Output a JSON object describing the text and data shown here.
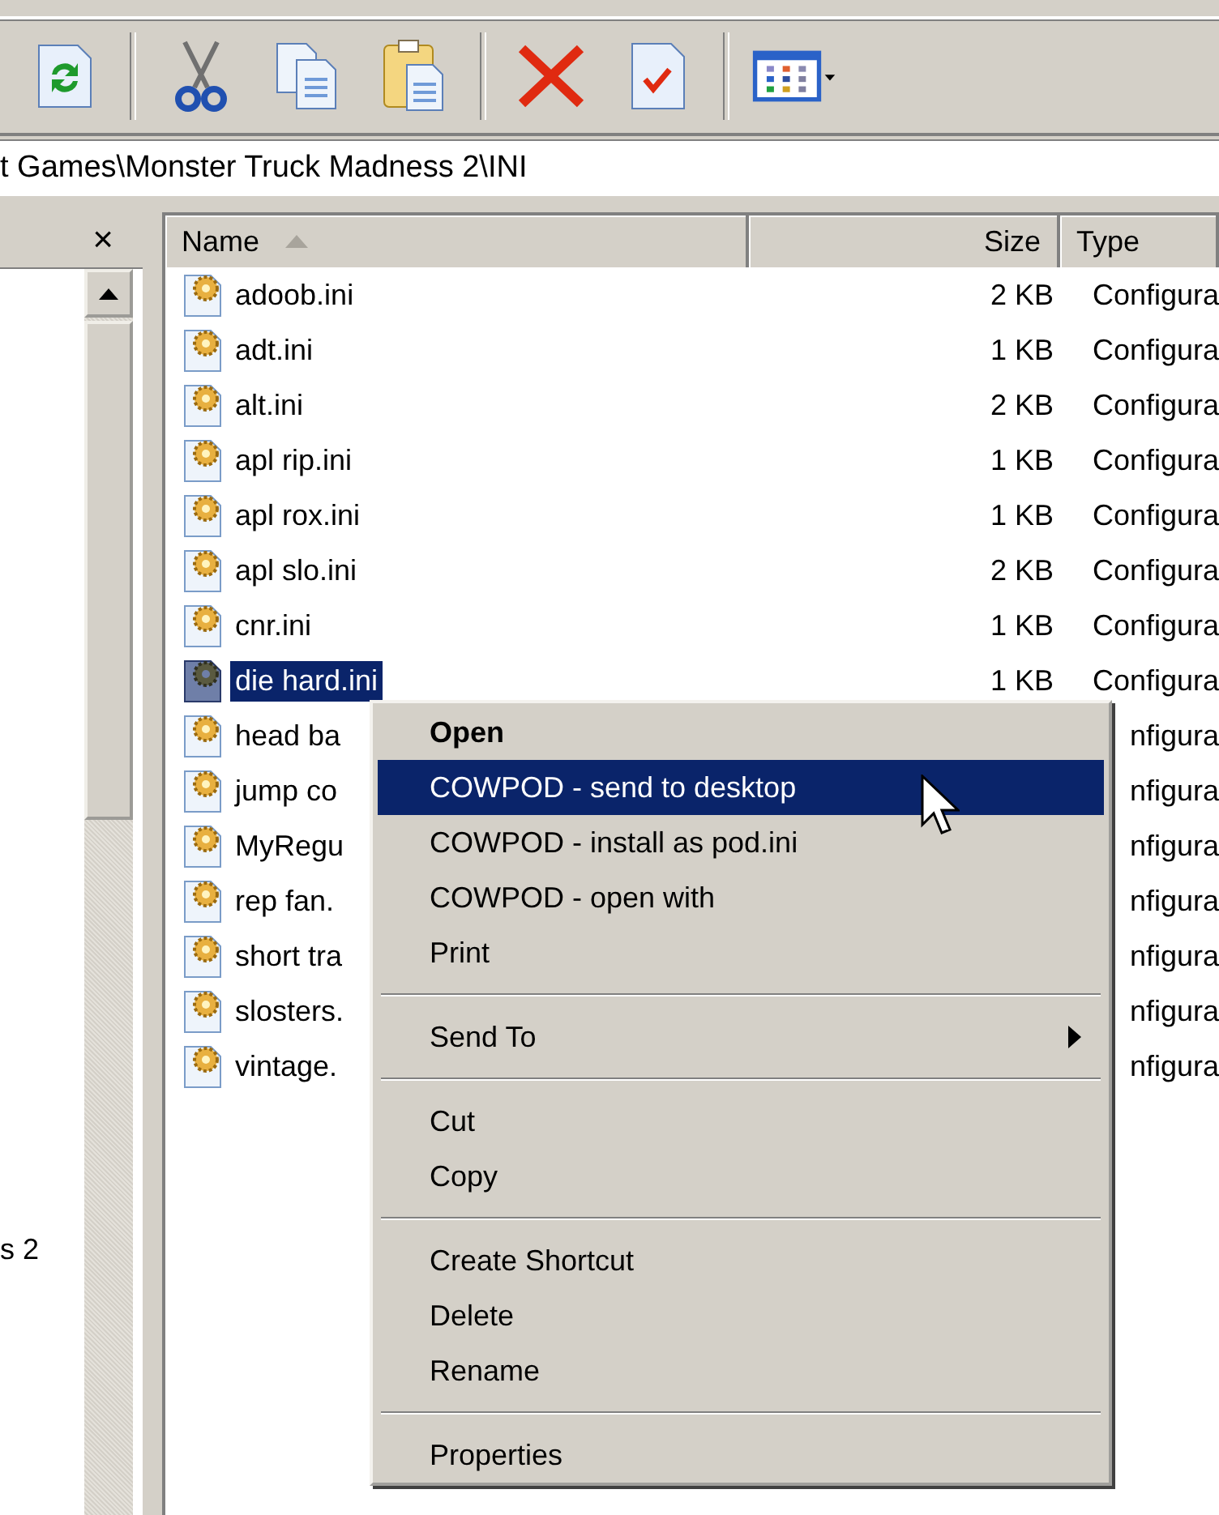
{
  "address_bar": {
    "value": "t Games\\Monster Truck Madness 2\\INI"
  },
  "left_pane": {
    "close": "×",
    "tree_items": [
      "s 2"
    ]
  },
  "file_list": {
    "columns": [
      {
        "label": "Name",
        "sorted": true
      },
      {
        "label": "Size",
        "sorted": false
      },
      {
        "label": "Type",
        "sorted": false
      }
    ],
    "rows": [
      {
        "name": "adoob.ini",
        "size": "2 KB",
        "type": "Configura",
        "selected": false
      },
      {
        "name": "adt.ini",
        "size": "1 KB",
        "type": "Configura",
        "selected": false
      },
      {
        "name": "alt.ini",
        "size": "2 KB",
        "type": "Configura",
        "selected": false
      },
      {
        "name": "apl rip.ini",
        "size": "1 KB",
        "type": "Configura",
        "selected": false
      },
      {
        "name": "apl rox.ini",
        "size": "1 KB",
        "type": "Configura",
        "selected": false
      },
      {
        "name": "apl slo.ini",
        "size": "2 KB",
        "type": "Configura",
        "selected": false
      },
      {
        "name": "cnr.ini",
        "size": "1 KB",
        "type": "Configura",
        "selected": false
      },
      {
        "name": "die hard.ini",
        "size": "1 KB",
        "type": "Configura",
        "selected": true
      },
      {
        "name": "head ba",
        "type": "nfigura",
        "selected": false
      },
      {
        "name": "jump co",
        "type": "nfigura",
        "selected": false
      },
      {
        "name": "MyRegu",
        "type": "nfigura",
        "selected": false
      },
      {
        "name": "rep fan.",
        "type": "nfigura",
        "selected": false
      },
      {
        "name": "short tra",
        "type": "nfigura",
        "selected": false
      },
      {
        "name": "slosters.",
        "type": "nfigura",
        "selected": false
      },
      {
        "name": "vintage.",
        "type": "nfigura",
        "selected": false
      }
    ]
  },
  "context_menu": {
    "items": [
      {
        "kind": "item",
        "label": "Open",
        "default": true,
        "selected": false
      },
      {
        "kind": "item",
        "label": "COWPOD - send to desktop",
        "default": false,
        "selected": true
      },
      {
        "kind": "item",
        "label": "COWPOD - install as pod.ini",
        "default": false,
        "selected": false
      },
      {
        "kind": "item",
        "label": "COWPOD - open with",
        "default": false,
        "selected": false
      },
      {
        "kind": "item",
        "label": "Print",
        "default": false,
        "selected": false
      },
      {
        "kind": "separator"
      },
      {
        "kind": "submenu",
        "label": "Send To",
        "default": false,
        "selected": false
      },
      {
        "kind": "separator"
      },
      {
        "kind": "item",
        "label": "Cut",
        "default": false,
        "selected": false
      },
      {
        "kind": "item",
        "label": "Copy",
        "default": false,
        "selected": false
      },
      {
        "kind": "separator"
      },
      {
        "kind": "item",
        "label": "Create Shortcut",
        "default": false,
        "selected": false
      },
      {
        "kind": "item",
        "label": "Delete",
        "default": false,
        "selected": false
      },
      {
        "kind": "item",
        "label": "Rename",
        "default": false,
        "selected": false
      },
      {
        "kind": "separator"
      },
      {
        "kind": "item",
        "label": "Properties",
        "default": false,
        "selected": false
      }
    ]
  }
}
